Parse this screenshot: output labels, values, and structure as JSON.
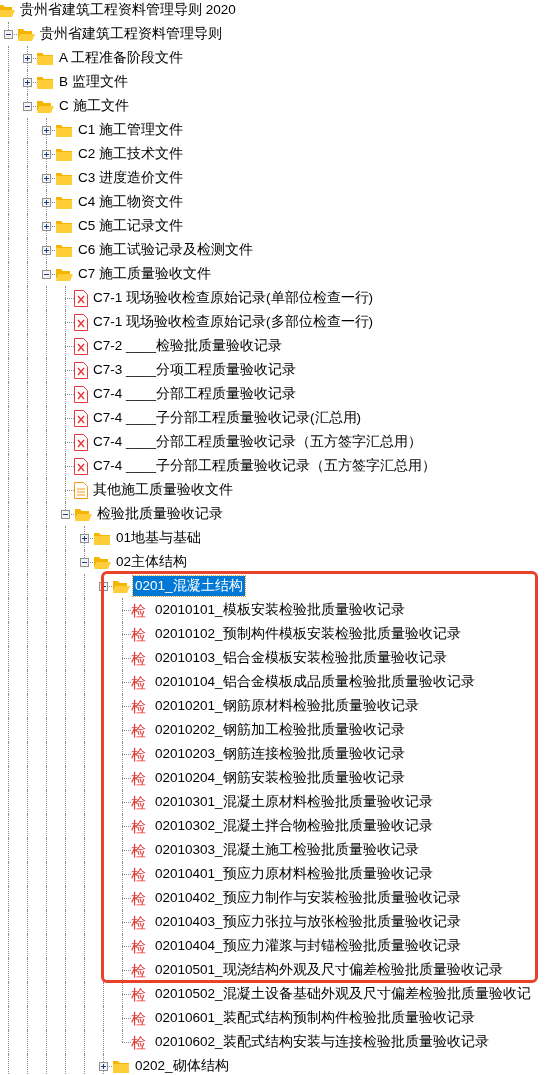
{
  "annotation": {
    "kind": "box"
  },
  "tree": {
    "kind": "folder",
    "label": "贵州省建筑工程资料管理导则 2020",
    "expanded": true,
    "selected": false,
    "children": [
      {
        "kind": "folder",
        "label": "贵州省建筑工程资料管理导则",
        "expanded": true,
        "selected": false,
        "children": [
          {
            "kind": "folder",
            "label": "A 工程准备阶段文件",
            "expanded": false,
            "selected": false
          },
          {
            "kind": "folder",
            "label": "B 监理文件",
            "expanded": false,
            "selected": false
          },
          {
            "kind": "folder",
            "label": "C 施工文件",
            "expanded": true,
            "selected": false,
            "children": [
              {
                "kind": "folder",
                "label": "C1 施工管理文件",
                "expanded": false,
                "selected": false
              },
              {
                "kind": "folder",
                "label": "C2 施工技术文件",
                "expanded": false,
                "selected": false
              },
              {
                "kind": "folder",
                "label": "C3 进度造价文件",
                "expanded": false,
                "selected": false
              },
              {
                "kind": "folder",
                "label": "C4 施工物资文件",
                "expanded": false,
                "selected": false
              },
              {
                "kind": "folder",
                "label": "C5 施工记录文件",
                "expanded": false,
                "selected": false
              },
              {
                "kind": "folder",
                "label": "C6 施工试验记录及检测文件",
                "expanded": false,
                "selected": false
              },
              {
                "kind": "folder",
                "label": "C7 施工质量验收文件",
                "expanded": true,
                "selected": false,
                "children": [
                  {
                    "kind": "form",
                    "label": "C7-1 现场验收检查原始记录(单部位检查一行)",
                    "selected": false
                  },
                  {
                    "kind": "form",
                    "label": "C7-1 现场验收检查原始记录(多部位检查一行)",
                    "selected": false
                  },
                  {
                    "kind": "form",
                    "label": "C7-2 ____检验批质量验收记录",
                    "selected": false
                  },
                  {
                    "kind": "form",
                    "label": "C7-3 ____分项工程质量验收记录",
                    "selected": false
                  },
                  {
                    "kind": "form",
                    "label": "C7-4 ____分部工程质量验收记录",
                    "selected": false
                  },
                  {
                    "kind": "form",
                    "label": "C7-4 ____子分部工程质量验收记录(汇总用)",
                    "selected": false
                  },
                  {
                    "kind": "form",
                    "label": "C7-4 ____分部工程质量验收记录（五方签字汇总用）",
                    "selected": false
                  },
                  {
                    "kind": "form",
                    "label": "C7-4 ____子分部工程质量验收记录（五方签字汇总用）",
                    "selected": false
                  },
                  {
                    "kind": "document",
                    "label": "其他施工质量验收文件",
                    "selected": false
                  },
                  {
                    "kind": "folder",
                    "label": "检验批质量验收记录",
                    "expanded": true,
                    "selected": false,
                    "children": [
                      {
                        "kind": "folder",
                        "label": "01地基与基础",
                        "expanded": false,
                        "selected": false
                      },
                      {
                        "kind": "folder",
                        "label": "02主体结构",
                        "expanded": true,
                        "selected": false,
                        "children": [
                          {
                            "kind": "folder",
                            "label": "0201_混凝土结构",
                            "expanded": true,
                            "selected": true,
                            "children": [
                              {
                                "kind": "inspection",
                                "badge": "检",
                                "label": "02010101_模板安装检验批质量验收记录",
                                "selected": false
                              },
                              {
                                "kind": "inspection",
                                "badge": "检",
                                "label": "02010102_预制构件模板安装检验批质量验收记录",
                                "selected": false
                              },
                              {
                                "kind": "inspection",
                                "badge": "检",
                                "label": "02010103_铝合金模板安装检验批质量验收记录",
                                "selected": false
                              },
                              {
                                "kind": "inspection",
                                "badge": "检",
                                "label": "02010104_铝合金模板成品质量检验批质量验收记录",
                                "selected": false
                              },
                              {
                                "kind": "inspection",
                                "badge": "检",
                                "label": "02010201_钢筋原材料检验批质量验收记录",
                                "selected": false
                              },
                              {
                                "kind": "inspection",
                                "badge": "检",
                                "label": "02010202_钢筋加工检验批质量验收记录",
                                "selected": false
                              },
                              {
                                "kind": "inspection",
                                "badge": "检",
                                "label": "02010203_钢筋连接检验批质量验收记录",
                                "selected": false
                              },
                              {
                                "kind": "inspection",
                                "badge": "检",
                                "label": "02010204_钢筋安装检验批质量验收记录",
                                "selected": false
                              },
                              {
                                "kind": "inspection",
                                "badge": "检",
                                "label": "02010301_混凝土原材料检验批质量验收记录",
                                "selected": false
                              },
                              {
                                "kind": "inspection",
                                "badge": "检",
                                "label": "02010302_混凝土拌合物检验批质量验收记录",
                                "selected": false
                              },
                              {
                                "kind": "inspection",
                                "badge": "检",
                                "label": "02010303_混凝土施工检验批质量验收记录",
                                "selected": false
                              },
                              {
                                "kind": "inspection",
                                "badge": "检",
                                "label": "02010401_预应力原材料检验批质量验收记录",
                                "selected": false
                              },
                              {
                                "kind": "inspection",
                                "badge": "检",
                                "label": "02010402_预应力制作与安装检验批质量验收记录",
                                "selected": false
                              },
                              {
                                "kind": "inspection",
                                "badge": "检",
                                "label": "02010403_预应力张拉与放张检验批质量验收记录",
                                "selected": false
                              },
                              {
                                "kind": "inspection",
                                "badge": "检",
                                "label": "02010404_预应力灌浆与封锚检验批质量验收记录",
                                "selected": false
                              },
                              {
                                "kind": "inspection",
                                "badge": "检",
                                "label": "02010501_现浇结构外观及尺寸偏差检验批质量验收记录",
                                "selected": false
                              },
                              {
                                "kind": "inspection",
                                "badge": "检",
                                "label": "02010502_混凝土设备基础外观及尺寸偏差检验批质量验收记",
                                "selected": false
                              },
                              {
                                "kind": "inspection",
                                "badge": "检",
                                "label": "02010601_装配式结构预制构件检验批质量验收记录",
                                "selected": false
                              },
                              {
                                "kind": "inspection",
                                "badge": "检",
                                "label": "02010602_装配式结构安装与连接检验批质量验收记录",
                                "selected": false
                              }
                            ]
                          },
                          {
                            "kind": "folder",
                            "label": "0202_砌体结构",
                            "expanded": false,
                            "selected": false
                          }
                        ]
                      }
                    ]
                  }
                ]
              }
            ]
          }
        ]
      }
    ]
  }
}
